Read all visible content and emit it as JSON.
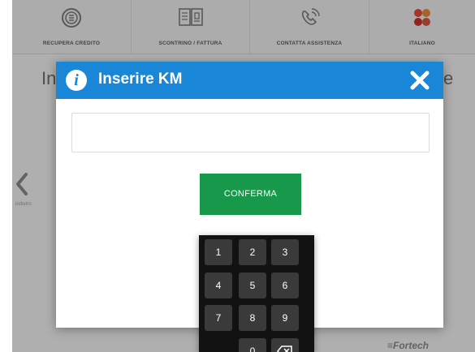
{
  "topbar": {
    "items": [
      {
        "label": "RECUPERA CREDITO",
        "icon": "coin-icon"
      },
      {
        "label": "SCONTRINO / FATTURA",
        "icon": "receipt-icon"
      },
      {
        "label": "CONTATTA ASSISTENZA",
        "icon": "phone-icon"
      },
      {
        "label": "ITALIANO",
        "icon": "language-icon"
      }
    ]
  },
  "background": {
    "title_left": "In",
    "title_right": "e",
    "back_label": "indietro"
  },
  "dialog": {
    "title": "Inserire KM",
    "input_value": "",
    "confirm_label": "CONFERMA"
  },
  "keypad": {
    "keys": [
      "1",
      "2",
      "3",
      "4",
      "5",
      "6",
      "7",
      "8",
      "9",
      "",
      "0",
      "backspace"
    ]
  },
  "brand": "≡Fortech",
  "colors": {
    "header_blue": "#1a86d8",
    "confirm_green": "#18984a",
    "keypad_bg": "#121212"
  }
}
